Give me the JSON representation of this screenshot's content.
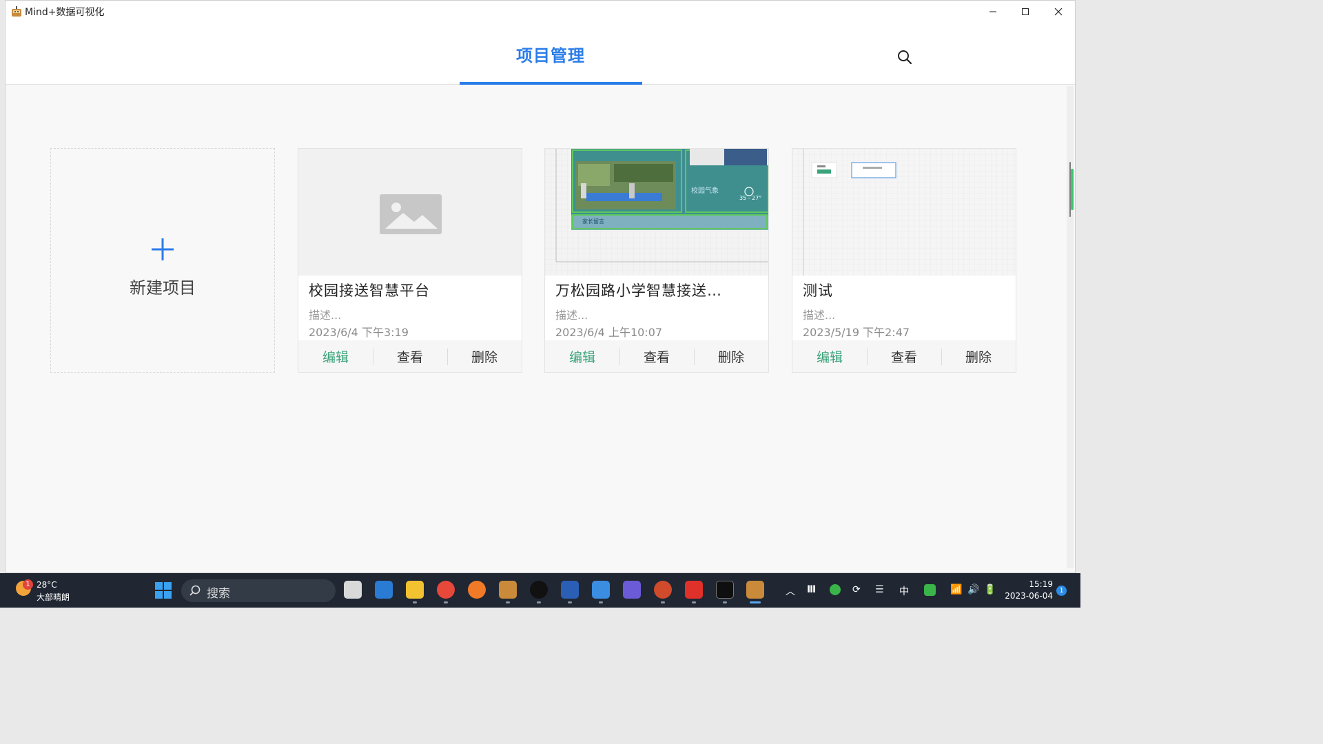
{
  "window": {
    "title": "Mind+数据可视化"
  },
  "header": {
    "tab_title": "项目管理"
  },
  "new_project": {
    "label": "新建项目"
  },
  "projects": [
    {
      "name": "校园接送智慧平台",
      "desc": "描述...",
      "date": "2023/6/4   下午3:19",
      "thumb": "placeholder-image-icon"
    },
    {
      "name": "万松园路小学智慧接送…",
      "desc": "描述...",
      "date": "2023/6/4   上午10:07",
      "thumb": "dashboard-screenshot"
    },
    {
      "name": "测试",
      "desc": "描述...",
      "date": "2023/5/19   下午2:47",
      "thumb": "grid-canvas-screenshot"
    }
  ],
  "actions": {
    "edit": "编辑",
    "view": "查看",
    "delete": "删除"
  },
  "thumb_texts": {
    "parent_message": "家长留言",
    "campus_weather": "校园气象",
    "temperature": "35 - 27°"
  },
  "taskbar": {
    "weather_badge": "1",
    "temperature": "28°C",
    "weather": "大部晴朗",
    "search_label": "搜索",
    "ime": "中",
    "time": "15:19",
    "date": "2023-06-04",
    "notifications": "1"
  },
  "colors": {
    "accent": "#2b7de9",
    "edit_green": "#3aa37a",
    "taskbar": "#202733"
  }
}
